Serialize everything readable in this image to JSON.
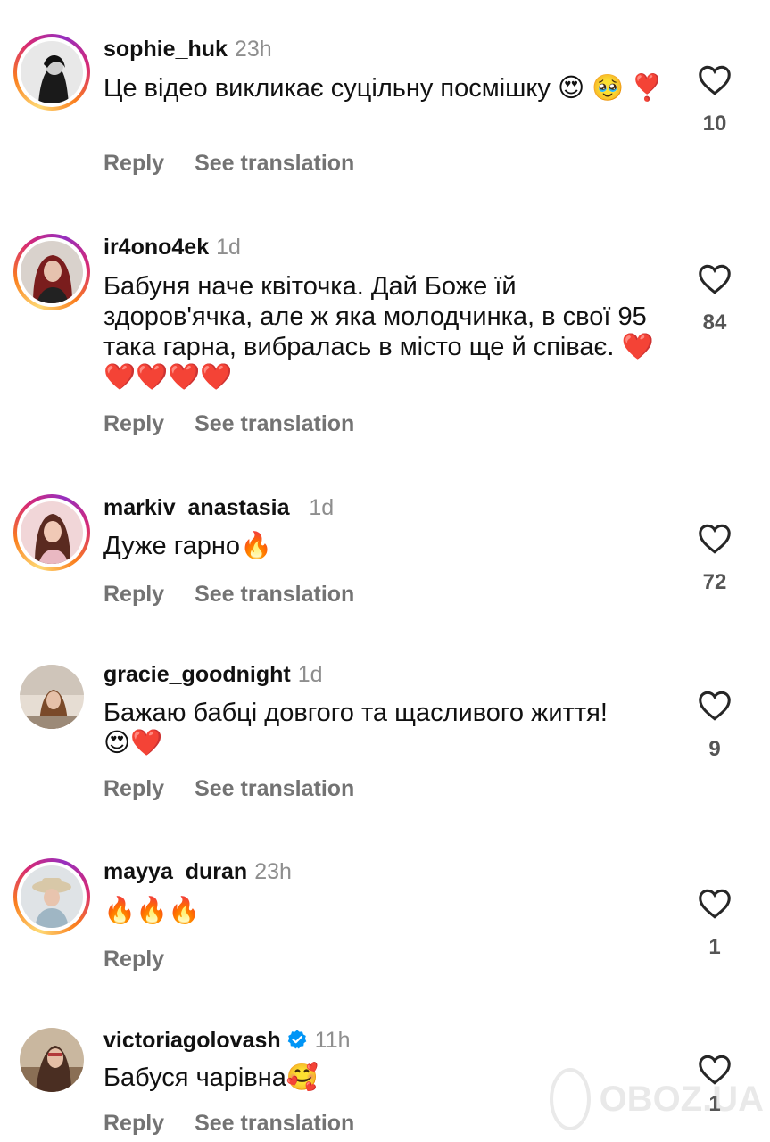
{
  "comments": [
    {
      "username": "sophie_huk",
      "time": "23h",
      "text": "Це відео викликає суцільну посмішку 😍 🥹 ❣️",
      "reply": "Reply",
      "translate": "See translation",
      "likes": "10",
      "story_ring": true
    },
    {
      "username": "ir4ono4ek",
      "time": "1d",
      "text": "Бабуня наче квіточка. Дай Боже їй здоров'ячка, але ж яка молодчинка, в свої 95 така гарна, вибралась в місто ще й співає. ❤️❤️❤️❤️❤️",
      "reply": "Reply",
      "translate": "See translation",
      "likes": "84",
      "story_ring": true
    },
    {
      "username": "markiv_anastasia_",
      "time": "1d",
      "text": "Дуже гарно🔥",
      "reply": "Reply",
      "translate": "See translation",
      "likes": "72",
      "story_ring": true
    },
    {
      "username": "gracie_goodnight",
      "time": "1d",
      "text": "Бажаю бабці довгого та щасливого життя! 😍❤️",
      "reply": "Reply",
      "translate": "See translation",
      "likes": "9",
      "story_ring": false
    },
    {
      "username": "mayya_duran",
      "time": "23h",
      "text": "🔥🔥🔥",
      "reply": "Reply",
      "translate": "",
      "likes": "1",
      "story_ring": true
    },
    {
      "username": "victoriagolovash",
      "time": "11h",
      "text": "Бабуся чарівна🥰",
      "reply": "Reply",
      "translate": "See translation",
      "likes": "1",
      "story_ring": false,
      "verified": true
    }
  ],
  "watermark": {
    "text": "OBOZ.UA"
  },
  "colors": {
    "verified_badge": "#0095f6",
    "secondary_text": "#737373",
    "timestamp": "#8e8e8e"
  },
  "icons": {
    "like": "heart-outline-icon",
    "verified": "verified-badge-icon"
  }
}
